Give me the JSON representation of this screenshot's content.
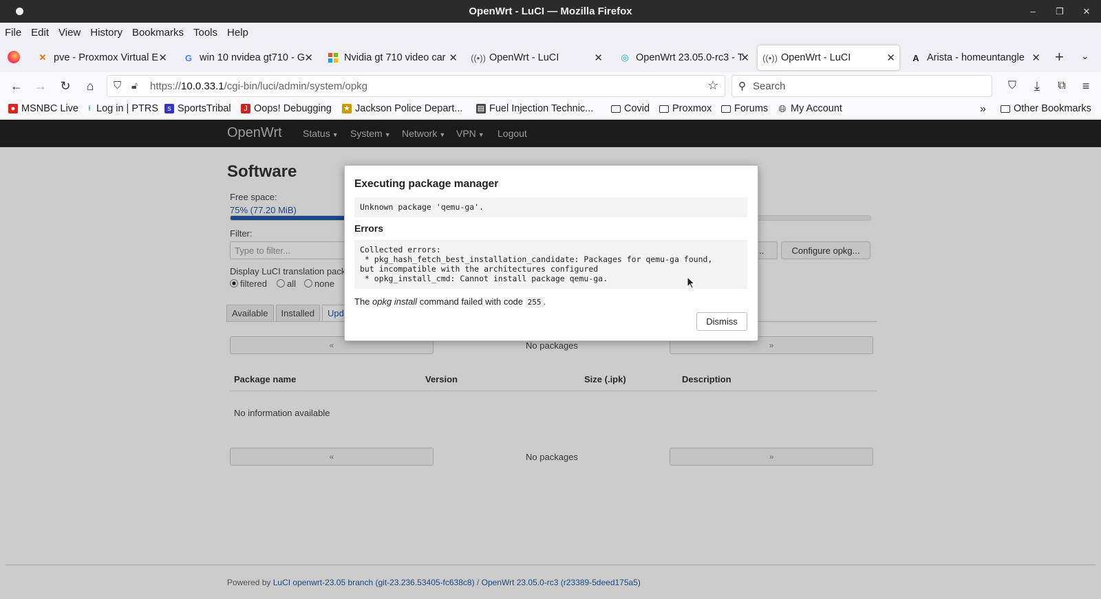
{
  "window": {
    "title": "OpenWrt - LuCI — Mozilla Firefox"
  },
  "menubar": [
    "File",
    "Edit",
    "View",
    "History",
    "Bookmarks",
    "Tools",
    "Help"
  ],
  "tabs": [
    {
      "label": "pve - Proxmox Virtual E",
      "icon": "proxmox-icon"
    },
    {
      "label": "win 10 nvidea gt710 - G",
      "icon": "google-icon"
    },
    {
      "label": "Nvidia gt 710 video car",
      "icon": "microsoft-icon"
    },
    {
      "label": "OpenWrt - LuCI",
      "icon": "openwrt-icon"
    },
    {
      "label": "OpenWrt 23.05.0-rc3 - T",
      "icon": "openwrt-forum-icon"
    },
    {
      "label": "OpenWrt - LuCI",
      "icon": "openwrt-icon",
      "active": true
    },
    {
      "label": "Arista - homeuntangle",
      "icon": "arista-icon"
    }
  ],
  "navbar": {
    "url_prefix": "https://",
    "url_host": "10.0.33.1",
    "url_path": "/cgi-bin/luci/admin/system/opkg",
    "search_placeholder": "Search"
  },
  "bookmarks": [
    {
      "label": "MSNBC Live",
      "icon": "msnbc-icon"
    },
    {
      "label": "Log in | PTRS",
      "icon": "ptrs-icon"
    },
    {
      "label": "SportsTribal",
      "icon": "sportstribal-icon"
    },
    {
      "label": "Oops! Debugging",
      "icon": "debugging-icon"
    },
    {
      "label": "Jackson Police Depart...",
      "icon": "police-icon"
    },
    {
      "label": "Fuel Injection Technic...",
      "icon": "fuel-injection-icon"
    },
    {
      "label": "Covid",
      "icon": "folder-icon"
    },
    {
      "label": "Proxmox",
      "icon": "folder-icon"
    },
    {
      "label": "Forums",
      "icon": "folder-icon"
    },
    {
      "label": "My Account",
      "icon": "globe-icon"
    },
    {
      "label": "Other Bookmarks",
      "icon": "folder-icon"
    }
  ],
  "luci": {
    "brand": "OpenWrt",
    "menu": [
      "Status",
      "System",
      "Network",
      "VPN",
      "Logout"
    ],
    "page_title": "Software",
    "free_space_label": "Free space:",
    "free_space_value": "75% (77.20 MiB)",
    "free_space_fraction": 0.75,
    "filter_label": "Filter:",
    "filter_placeholder": "Type to filter...",
    "update_lists_btn": "...",
    "configure_btn": "Configure opkg...",
    "translation_label": "Display LuCI translation pack",
    "radio_filtered": "filtered",
    "radio_all": "all",
    "radio_none": "none",
    "subtabs": [
      "Available",
      "Installed",
      "Upd"
    ],
    "pager_prev": "«",
    "pager_next": "»",
    "no_packages": "No packages",
    "columns": [
      "Package name",
      "Version",
      "Size (.ipk)",
      "Description"
    ],
    "no_info": "No information available",
    "footer_prefix": "Powered by",
    "footer_link1": "LuCI openwrt-23.05 branch (git-23.236.53405-fc638c8)",
    "footer_sep": "/",
    "footer_link2": "OpenWrt 23.05.0-rc3 (r23389-5deed175a5)"
  },
  "modal": {
    "title": "Executing package manager",
    "output": "Unknown package 'qemu-ga'.",
    "errors_heading": "Errors",
    "errors": "Collected errors:\n * pkg_hash_fetch_best_installation_candidate: Packages for qemu-ga found,\nbut incompatible with the architectures configured\n * opkg_install_cmd: Cannot install package qemu-ga.",
    "msg_prefix": "The",
    "msg_cmd": "opkg install",
    "msg_middle": "command failed with code",
    "msg_code": "255",
    "msg_suffix": ".",
    "dismiss": "Dismiss"
  }
}
